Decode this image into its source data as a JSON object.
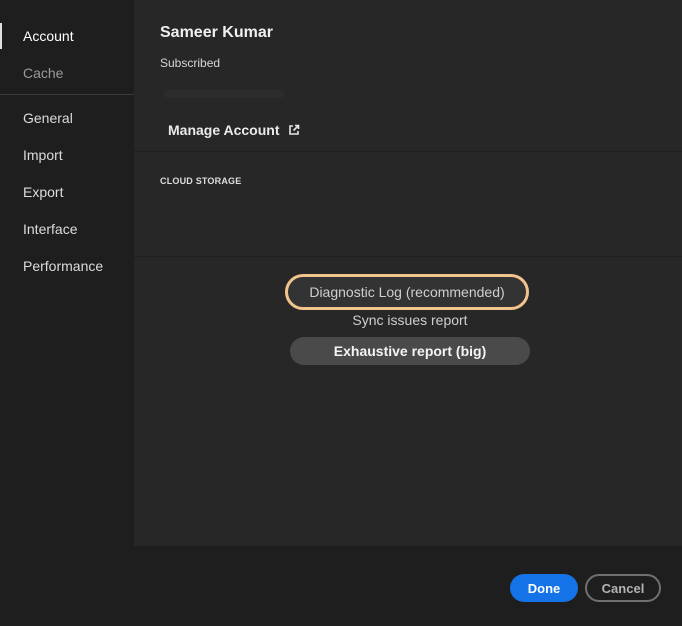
{
  "sidebar": {
    "items": [
      {
        "label": "Account"
      },
      {
        "label": "Cache"
      },
      {
        "label": "General"
      },
      {
        "label": "Import"
      },
      {
        "label": "Export"
      },
      {
        "label": "Interface"
      },
      {
        "label": "Performance"
      }
    ]
  },
  "account": {
    "user_name": "Sameer Kumar",
    "plan": "Subscribed",
    "manage_label": "Manage Account",
    "cloud_storage_label": "CLOUD STORAGE"
  },
  "reports": {
    "diagnostic": "Diagnostic Log (recommended)",
    "sync": "Sync issues report",
    "exhaustive": "Exhaustive report (big)"
  },
  "footer": {
    "done": "Done",
    "cancel": "Cancel"
  },
  "colors": {
    "accent": "#1473e6",
    "highlight": "#f2c48d"
  }
}
